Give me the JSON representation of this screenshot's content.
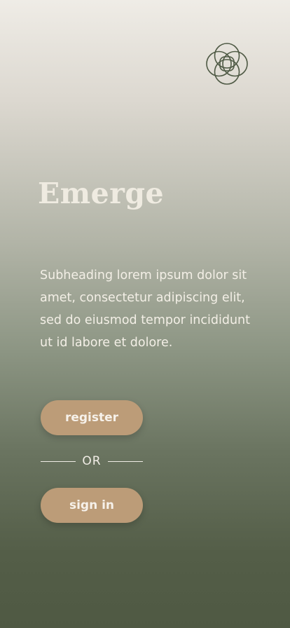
{
  "app": {
    "title": "Emerge",
    "logo_icon": "interlocking-circles-icon"
  },
  "intro": {
    "subheading": "Subheading lorem ipsum dolor sit amet, consectetur adipiscing elit, sed do eiusmod tempor incididunt ut id labore et dolore."
  },
  "actions": {
    "register_label": "register",
    "divider_text": "OR",
    "signin_label": "sign in"
  },
  "colors": {
    "button_fill": "#bc9c78",
    "logo_stroke": "#4f5a45",
    "text_light": "#f3efe6",
    "gradient_top": "#efece6",
    "gradient_bottom": "#4f5943"
  }
}
